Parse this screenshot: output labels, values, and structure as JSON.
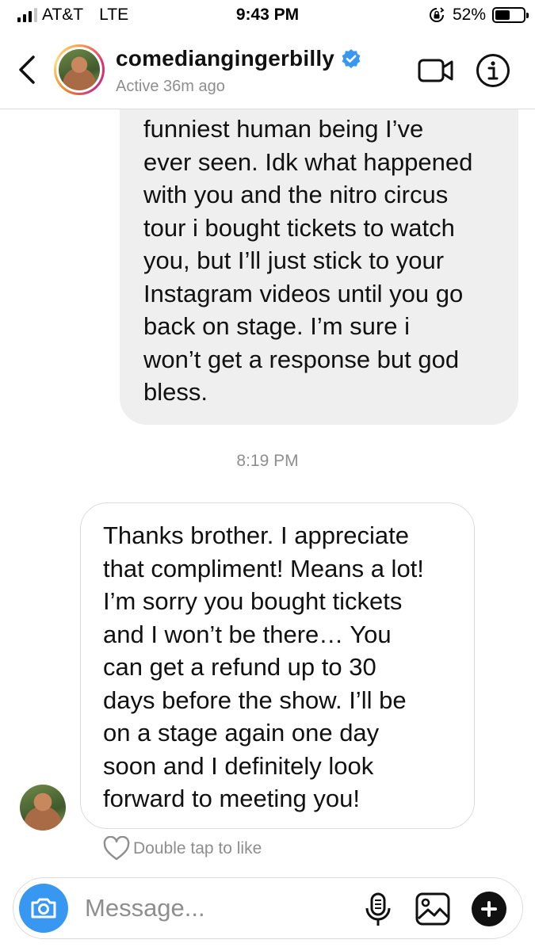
{
  "status_bar": {
    "carrier": "AT&T",
    "network": "LTE",
    "time": "9:43 PM",
    "battery": "52%",
    "battery_level": 0.52
  },
  "header": {
    "username": "comediangingerbilly",
    "active_status": "Active 36m ago",
    "verified": true
  },
  "messages": {
    "sent_text": "funniest human being I’ve\never seen. Idk what happened\nwith you and the nitro circus\ntour i bought tickets to watch\nyou, but I’ll just stick to your\nInstagram videos until you go\nback on stage. I’m sure i\nwon’t get a response but god\nbless.",
    "timestamp": "8:19 PM",
    "received_text": "Thanks brother. I appreciate\nthat compliment! Means a lot!\nI’m sorry you bought tickets\nand I won’t be there… You\ncan get a refund up to 30\ndays before the show. I’ll be\non a stage again one day\nsoon and I definitely look\nforward to meeting you!",
    "like_hint": "Double tap to like"
  },
  "composer": {
    "placeholder": "Message..."
  },
  "colors": {
    "accent": "#3897f0",
    "bubble_gray": "#efefef",
    "border": "#dbdbdb",
    "muted_text": "#8e8e8e"
  },
  "icons": [
    "back-chevron-icon",
    "verified-badge-icon",
    "video-camera-icon",
    "info-icon",
    "heart-icon",
    "camera-icon",
    "microphone-icon",
    "gallery-icon",
    "plus-icon"
  ]
}
